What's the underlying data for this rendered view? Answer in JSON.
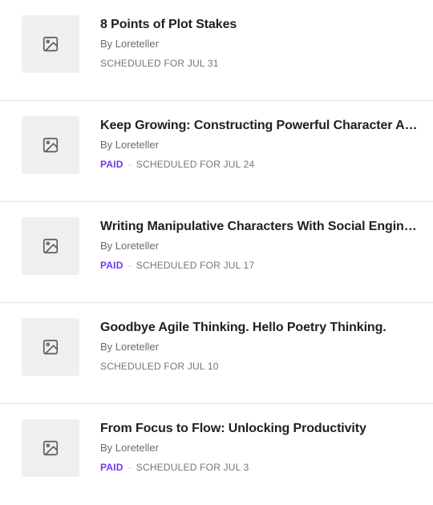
{
  "posts": [
    {
      "title": "8 Points of Plot Stakes",
      "author": "By Loreteller",
      "paid": false,
      "schedule": "SCHEDULED FOR JUL 31"
    },
    {
      "title": "Keep Growing: Constructing Powerful Character Arcs",
      "author": "By Loreteller",
      "paid": true,
      "paid_label": "PAID",
      "separator": "·",
      "schedule": "SCHEDULED FOR JUL 24"
    },
    {
      "title": "Writing Manipulative Characters With Social Engineering",
      "author": "By Loreteller",
      "paid": true,
      "paid_label": "PAID",
      "separator": "·",
      "schedule": "SCHEDULED FOR JUL 17"
    },
    {
      "title": "Goodbye Agile Thinking. Hello Poetry Thinking.",
      "author": "By Loreteller",
      "paid": false,
      "schedule": "SCHEDULED FOR JUL 10"
    },
    {
      "title": "From Focus to Flow: Unlocking Productivity",
      "author": "By Loreteller",
      "paid": true,
      "paid_label": "PAID",
      "separator": "·",
      "schedule": "SCHEDULED FOR JUL 3"
    }
  ],
  "colors": {
    "paid_accent": "#6e3aee",
    "thumbnail_bg": "#efefef",
    "divider": "#e6e6e6"
  },
  "icons": {
    "thumbnail": "image-placeholder-icon"
  }
}
